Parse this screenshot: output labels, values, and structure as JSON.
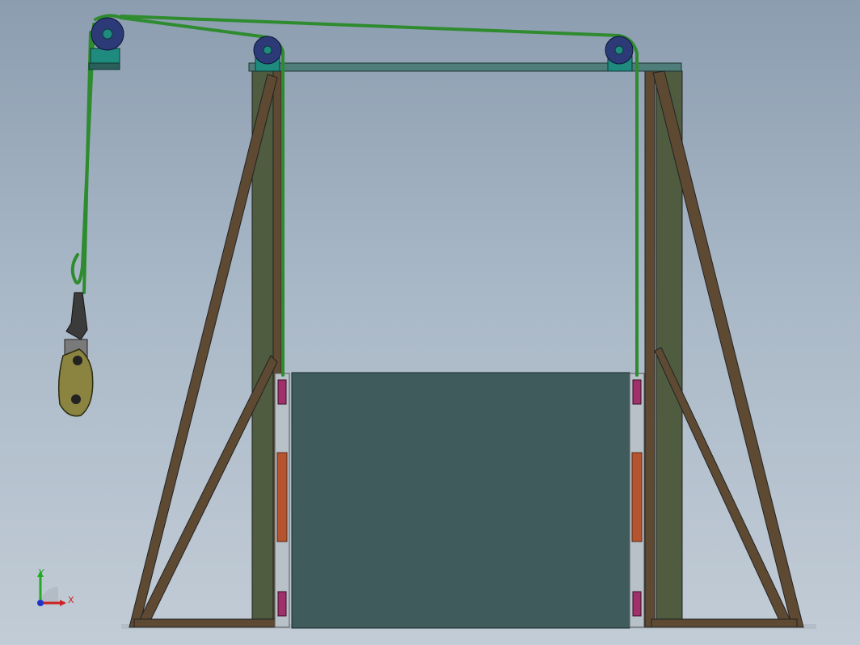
{
  "viewport": {
    "background_top": "#8c9db0",
    "background_bottom": "#c2ccd6"
  },
  "colors": {
    "frame_wood": "#5e4a33",
    "frame_post": "#4f5c3f",
    "top_beam": "#4f7d7a",
    "door_panel": "#3f5b5c",
    "rope": "#2e8b2e",
    "pulley_wheel": "#2c3a78",
    "pulley_bracket": "#1f8a7e",
    "hook_block": "#8b8340",
    "roller_accent": "#b5552f",
    "clamp": "#a0306a",
    "axis_x": "#cc2222",
    "axis_y": "#22aa22",
    "axis_z": "#2233cc"
  },
  "triad": {
    "x_label": "X",
    "y_label": "Y"
  }
}
